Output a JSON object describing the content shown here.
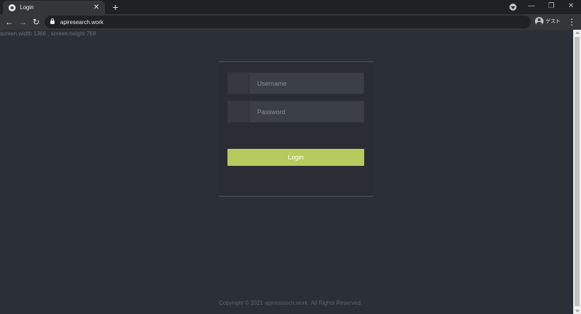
{
  "browser": {
    "tab_title": "Login",
    "tab_close": "✕",
    "new_tab": "+",
    "url": "apiresearch.work",
    "profile_label": "ゲスト",
    "back": "←",
    "forward": "→",
    "reload": "↻",
    "menu": "⋮",
    "minimize": "—",
    "restore": "❐",
    "close": "✕",
    "icons": {
      "favicon": "globe-icon",
      "profile_menu": "profile-dropdown-icon",
      "lock": "lock-icon",
      "avatar": "guest-avatar-icon"
    }
  },
  "page": {
    "screen_info": "screen.width 1366 , screen.height 768",
    "username_placeholder": "Username",
    "password_placeholder": "Password",
    "login_label": "Login",
    "copyright": "Copyright © 2021 apiresearch.work. All Rights Reserved."
  },
  "colors": {
    "background": "#2b3037",
    "panel": "#2a2d33",
    "input": "#3b3f47",
    "button": "#b5cb5e"
  }
}
